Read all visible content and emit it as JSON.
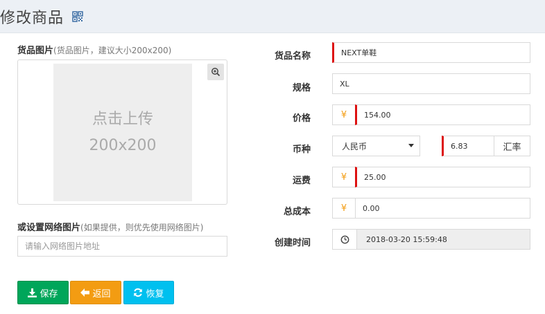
{
  "header": {
    "title": "修改商品"
  },
  "image_section": {
    "label": "货品图片",
    "hint": "(货品图片，建议大小200x200)",
    "placeholder_line1": "点击上传",
    "placeholder_line2": "200x200"
  },
  "network_image": {
    "label": "或设置网络图片",
    "hint": "(如果提供，则优先使用网络图片)",
    "placeholder": "请输入网络图片地址",
    "value": ""
  },
  "form": {
    "name": {
      "label": "货品名称",
      "value": "NEXT单鞋"
    },
    "spec": {
      "label": "规格",
      "value": "XL"
    },
    "price": {
      "label": "价格",
      "prefix": "¥",
      "value": "154.00"
    },
    "currency": {
      "label": "币种",
      "selected": "人民币",
      "rate_value": "6.83",
      "rate_label": "汇率"
    },
    "shipping": {
      "label": "运费",
      "prefix": "¥",
      "value": "25.00"
    },
    "total_cost": {
      "label": "总成本",
      "prefix": "¥",
      "value": "0.00"
    },
    "created": {
      "label": "创建时间",
      "value": "2018-03-20 15:59:48"
    }
  },
  "buttons": {
    "save": "保存",
    "back": "返回",
    "restore": "恢复"
  },
  "colors": {
    "save": "#00a65a",
    "back": "#f39c12",
    "restore": "#00c0ef",
    "required_marker": "#dd1111",
    "currency_symbol": "#f39c12"
  }
}
